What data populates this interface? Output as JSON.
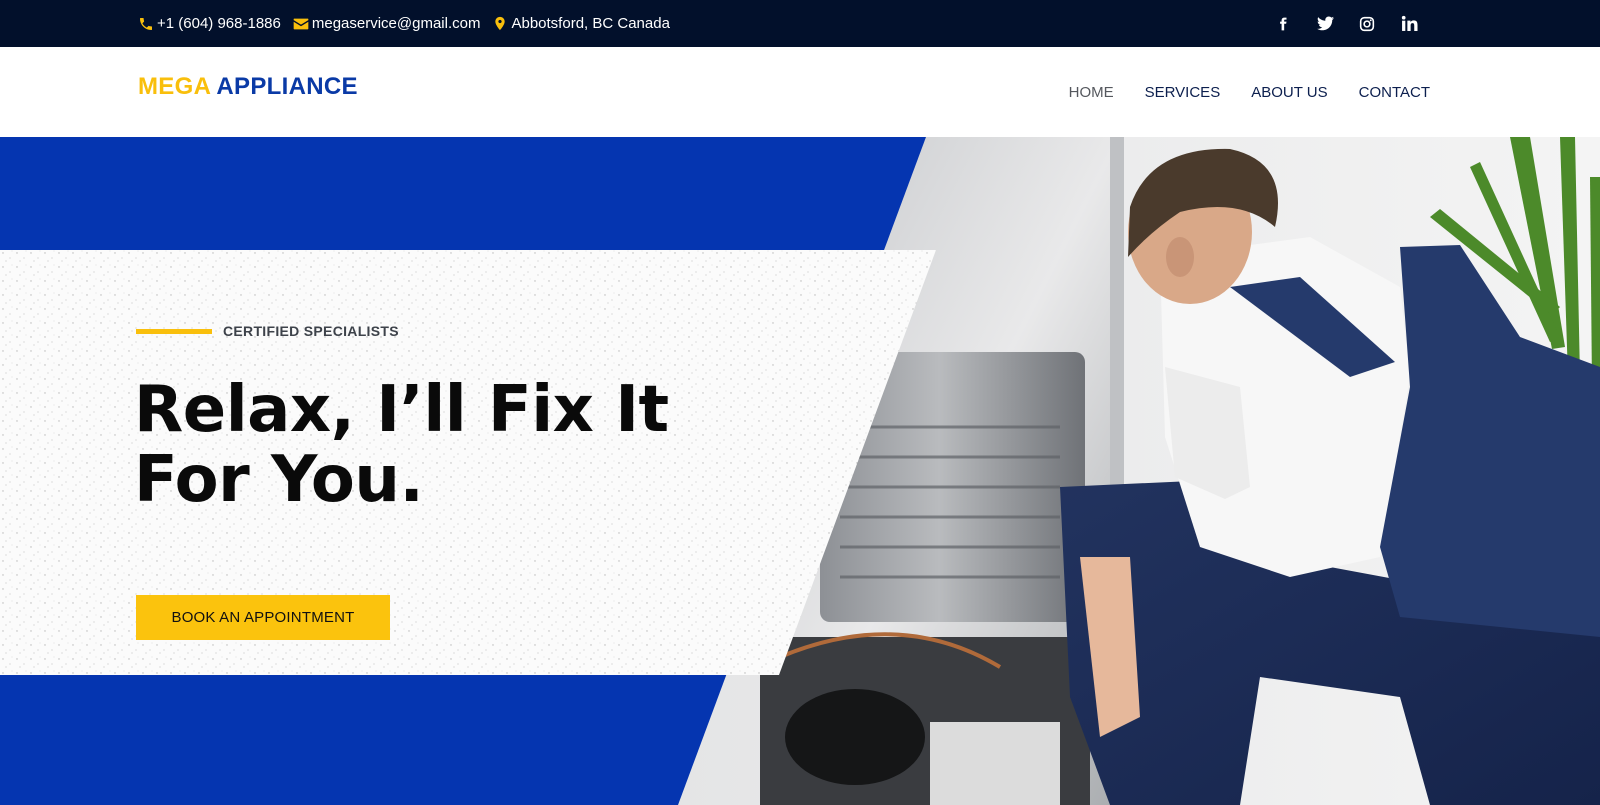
{
  "topbar": {
    "phone": "+1 (604) 968-1886",
    "email": "megaservice@gmail.com",
    "location": "Abbotsford, BC Canada",
    "social": [
      "facebook-icon",
      "twitter-icon",
      "instagram-icon",
      "linkedin-icon"
    ]
  },
  "header": {
    "logo_part1": "MEGA",
    "logo_part2": "APPLIANCE",
    "nav": [
      "HOME",
      "SERVICES",
      "ABOUT US",
      "CONTACT"
    ],
    "active_nav": "HOME"
  },
  "hero": {
    "eyebrow": "CERTIFIED SPECIALISTS",
    "title_line1": "Relax, I’ll Fix It",
    "title_line2": "For You.",
    "cta": "BOOK AN APPOINTMENT"
  },
  "colors": {
    "topbar_bg": "#02102b",
    "accent_yellow": "#f9bf0c",
    "brand_blue": "#0a3aa6",
    "nav_text": "#0c1f4e"
  }
}
